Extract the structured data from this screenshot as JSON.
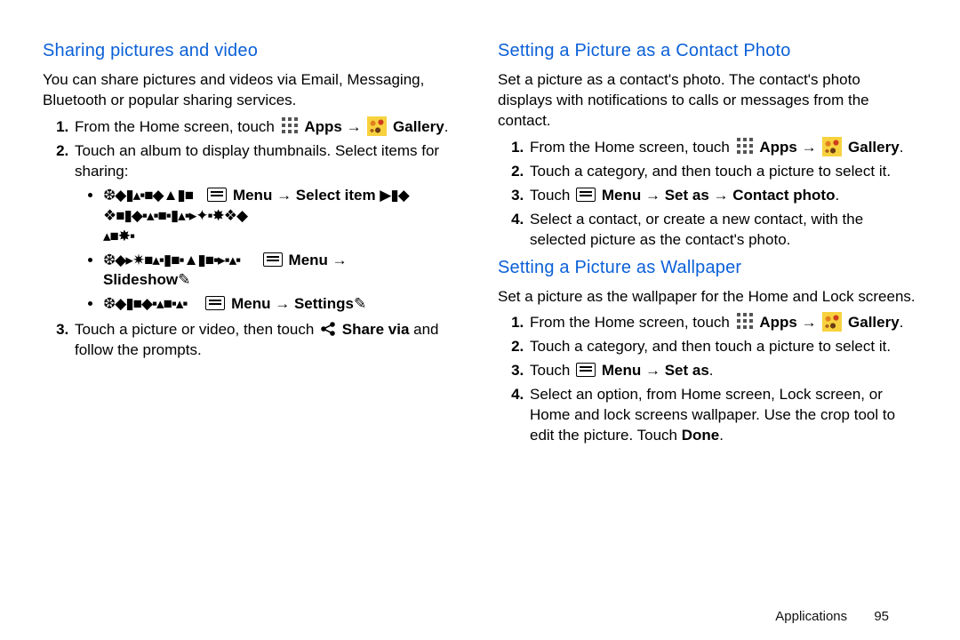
{
  "left": {
    "heading": "Sharing pictures and video",
    "intro": "You can share pictures and videos via Email, Messaging, Bluetooth or popular sharing services.",
    "s1a": "From the Home screen, touch ",
    "apps": "Apps",
    "arrow": " → ",
    "gallery": "Gallery",
    "dot": ".",
    "s2": "Touch an album to display thumbnails. Select items for sharing:",
    "b1a": "❆◆▮▴▪■◆▲▮■",
    "b1menu": "Menu",
    "b1arrow": " → ",
    "b1sel": "Select item",
    "b1b": "▶▮◆",
    "b1c": "❖■▮◆▪▴▪■▪▮▴▪▸✦▪✸❖◆",
    "b1d": "▴■✸▪",
    "b2a": "❆◆▸✷■▴▪▮■▪▲▮■▪▸▪▴▪",
    "b2menu": "Menu",
    "b2arrow": " → ",
    "b2slide": "Slideshow",
    "b2end": "✎",
    "b3a": "❆◆▮■◆▪▴■▪▴▪",
    "b3menu": "Menu",
    "b3arrow": " → ",
    "b3set": "Settings",
    "b3end": "✎",
    "s3a": "Touch a picture or video, then touch ",
    "s3share": "Share via",
    "s3b": " and follow the prompts."
  },
  "right": {
    "h1": "Setting a Picture as a Contact Photo",
    "p1": "Set a picture as a contact's photo. The contact's photo displays with notifications to calls or messages from the contact.",
    "r1a": "From the Home screen, touch ",
    "apps": "Apps",
    "arrow": " → ",
    "gallery": "Gallery",
    "dot": ".",
    "r2": "Touch a category, and then touch a picture to select it.",
    "r3a": "Touch ",
    "r3menu": "Menu",
    "r3arr": " → ",
    "r3setas": "Set as",
    "r3arr2": " → ",
    "r3cp": "Contact photo",
    "r4": "Select a contact, or create a new contact, with the selected picture as the contact's photo.",
    "h2": "Setting a Picture as Wallpaper",
    "p2": "Set a picture as the wallpaper for the Home and Lock screens.",
    "w1a": "From the Home screen, touch ",
    "w2": "Touch a category, and then touch a picture to select it.",
    "w3a": "Touch ",
    "w3menu": "Menu",
    "w3arr": " → ",
    "w3setas": "Set as",
    "w4a": "Select an option, from Home screen, Lock screen, or Home and lock screens wallpaper. Use the crop tool to edit the picture. Touch ",
    "w4done": "Done",
    "w4dot": "."
  },
  "footer": {
    "chapter": "Applications",
    "page": "95"
  }
}
